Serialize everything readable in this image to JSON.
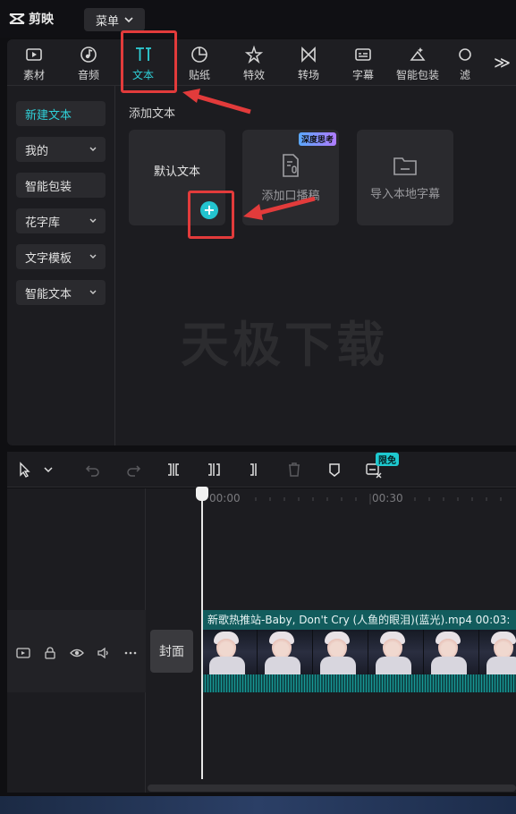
{
  "app": {
    "name": "剪映",
    "menu_label": "菜单"
  },
  "toolbar": {
    "items": [
      {
        "label": "素材",
        "icon": "media-icon"
      },
      {
        "label": "音频",
        "icon": "audio-icon"
      },
      {
        "label": "文本",
        "icon": "text-icon",
        "active": true
      },
      {
        "label": "贴纸",
        "icon": "sticker-icon"
      },
      {
        "label": "特效",
        "icon": "effects-icon"
      },
      {
        "label": "转场",
        "icon": "transition-icon"
      },
      {
        "label": "字幕",
        "icon": "subtitle-icon"
      },
      {
        "label": "智能包装",
        "icon": "smart-pack-icon"
      },
      {
        "label": "滤",
        "icon": "filter-icon"
      }
    ],
    "more": "≫"
  },
  "sidebar": {
    "items": [
      {
        "label": "新建文本",
        "active": true,
        "dropdown": false
      },
      {
        "label": "我的",
        "dropdown": true
      },
      {
        "label": "智能包装",
        "dropdown": false
      },
      {
        "label": "花字库",
        "dropdown": true
      },
      {
        "label": "文字模板",
        "dropdown": true
      },
      {
        "label": "智能文本",
        "dropdown": true
      }
    ]
  },
  "content": {
    "section_title": "添加文本",
    "cards": [
      {
        "label": "默认文本"
      },
      {
        "label": "添加口播稿",
        "badge": "深度思考"
      },
      {
        "label": "导入本地字幕"
      }
    ],
    "watermark": "天极下载"
  },
  "timeline_toolbar": {
    "badge": "限免"
  },
  "timeline": {
    "ruler": [
      "00:00",
      "00:30"
    ],
    "cover_label": "封面",
    "clip_title": "新歌热推站-Baby, Don't Cry (人鱼的眼泪)(蓝光).mp4   00:03:"
  },
  "colors": {
    "accent": "#2fd0d8",
    "annotation": "#e23b3b"
  }
}
